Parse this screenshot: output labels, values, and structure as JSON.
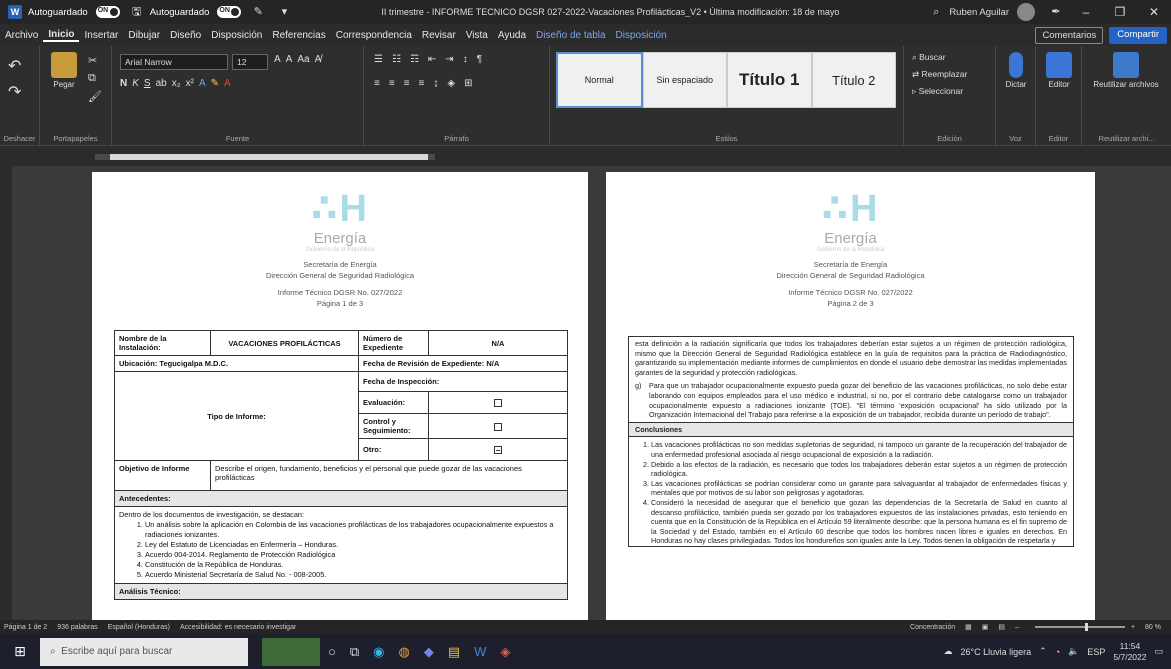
{
  "titlebar": {
    "autosave_label_1": "Autoguardado",
    "autosave_toggle_1": "ON",
    "autosave_label_2": "Autoguardado",
    "autosave_toggle_2": "ON",
    "doc_title": "II trimestre - INFORME TECNICO DGSR 027-2022-Vacaciones Profilácticas_V2 • Última modificación: 18 de mayo",
    "user": "Ruben Aguilar"
  },
  "menu": {
    "items": [
      "Archivo",
      "Inicio",
      "Insertar",
      "Dibujar",
      "Diseño",
      "Disposición",
      "Referencias",
      "Correspondencia",
      "Revisar",
      "Vista",
      "Ayuda",
      "Diseño de tabla",
      "Disposición"
    ],
    "comments": "Comentarios",
    "share": "Compartir"
  },
  "ribbon": {
    "pegar": "Pegar",
    "font_name": "Arial Narrow",
    "font_size": "12",
    "styles": [
      "Normal",
      "Sin espaciado",
      "Título 1",
      "Título 2"
    ],
    "buscar": "Buscar",
    "reemplazar": "Reemplazar",
    "seleccionar": "Seleccionar",
    "dictar": "Dictar",
    "editor": "Editor",
    "reutilizar": "Reutilizar archivos",
    "groups": [
      "Deshacer",
      "Portapapeles",
      "Fuente",
      "Párrafo",
      "Estilos",
      "Edición",
      "Voz",
      "Editor",
      "Reutilizar archi..."
    ]
  },
  "page1": {
    "logo_text": "Energía",
    "gob": "Gobierno de la República",
    "sec1": "Secretaría de Energía",
    "sec2": "Dirección General de Seguridad Radiológica",
    "informe": "Informe Técnico DGSR No. 027/2022",
    "pagina": "Página 1 de 3",
    "table": {
      "nombre_label": "Nombre de la Instalación:",
      "nombre_value": "VACACIONES PROFILÁCTICAS",
      "expediente_label": "Número de Expediente",
      "expediente_value": "N/A",
      "ubicacion": "Ubicación: Tegucigalpa M.D.C.",
      "fecha_rev": "Fecha de Revisión de Expediente: N/A",
      "fecha_insp": "Fecha de Inspección:",
      "tipo_label": "Tipo de Informe:",
      "evaluacion": "Evaluación:",
      "control": "Control y Seguimiento:",
      "otro": "Otro:",
      "objetivo_label": "Objetivo de Informe",
      "objetivo_value": "Describe el origen, fundamento, beneficios y el personal que puede gozar de las vacaciones profilácticas",
      "antecedentes": "Antecedentes:",
      "antec_intro": "Dentro de los documentos de investigación, se destacan:",
      "antec_items": [
        "Un análisis sobre la aplicación en Colombia de las vacaciones profilácticas de los trabajadores ocupacionalmente expuestos a radiaciones ionizantes.",
        "Ley del Estatuto de Licenciadas en Enfermería – Honduras.",
        "Acuerdo 004-2014. Reglamento de Protección Radiológica",
        "Constitución de la República de Honduras.",
        "Acuerdo Ministerial Secretaría de Salud No. - 008-2005."
      ],
      "analisis": "Análisis Técnico:"
    }
  },
  "page2": {
    "logo_text": "Energía",
    "gob": "Gobierno de la República",
    "sec1": "Secretaría de Energía",
    "sec2": "Dirección General de Seguridad Radiológica",
    "informe": "Informe Técnico DGSR No. 027/2022",
    "pagina": "Página 2 de 3",
    "para1": "esta definición a la radiación significaría que todos los trabajadores deberían estar sujetos a un régimen de protección radiológica, mismo que la Dirección General de Seguridad Radiológica establece en la guía de requisitos para la práctica de Radiodiagnóstico, garantizando su implementación mediante informes de cumplimientos en donde el usuario debe demostrar las medidas implementadas garantes de la seguridad y protección radiológicas.",
    "g_letter": "g)",
    "g_text": "Para que un trabajador ocupacionalmente expuesto pueda gozar del beneficio de las vacaciones profilácticas, no solo debe estar laborando con equipos empleados para el uso médico e industrial, si no, por el contrario debe catalogarse como un trabajador ocupacionalmente expuesto a radiaciones ionizante (TOE). \"El término 'exposición ocupacional' ha sido utilizado por la Organización Internacional del Trabajo para referirse a la exposición de un trabajador, recibida durante un período de trabajo\".",
    "conclusiones": "Conclusiones",
    "conc_items": [
      "Las vacaciones profilácticas no son medidas supletorias de seguridad, ni tampoco un garante de la recuperación del trabajador de una enfermedad profesional asociada al riesgo ocupacional de exposición a la radiación.",
      "Debido a los efectos de la radiación, es necesario que todos los trabajadores deberán estar sujetos a un régimen de protección radiológica.",
      "Las vacaciones profilácticas se podrían considerar como un garante para salvaguardar al trabajador de enfermedades físicas y mentales que por motivos de su labor son peligrosas y agotadoras.",
      "Consideró la necesidad de asegurar que el beneficio que gozan las dependencias de la Secretaría de Salud en cuanto al descanso profiláctico, también pueda ser gozado por los trabajadores expuestos de las instalaciones privadas, esto teniendo en cuenta que en la Constitución de la República en el Artículo 59 literalmente describe: que la persona humana es el fin supremo de la Sociedad y del Estado, también en el Artículo 60 describe que todos los hombres nacen libres e iguales en derechos. En Honduras no hay clases privilegiadas. Todos los hondureños son iguales ante la Ley. Todos tienen la obligación de respetarla y"
    ]
  },
  "statusbar": {
    "page": "Página 1 de 2",
    "words": "936 palabras",
    "lang": "Español (Honduras)",
    "access": "Accesibilidad: es necesario investigar",
    "focus": "Concentración",
    "zoom": "80 %"
  },
  "taskbar": {
    "search": "Escribe aquí para buscar",
    "weather": "26°C Lluvia ligera",
    "lang": "ESP",
    "time": "11:54",
    "date": "5/7/2022"
  }
}
